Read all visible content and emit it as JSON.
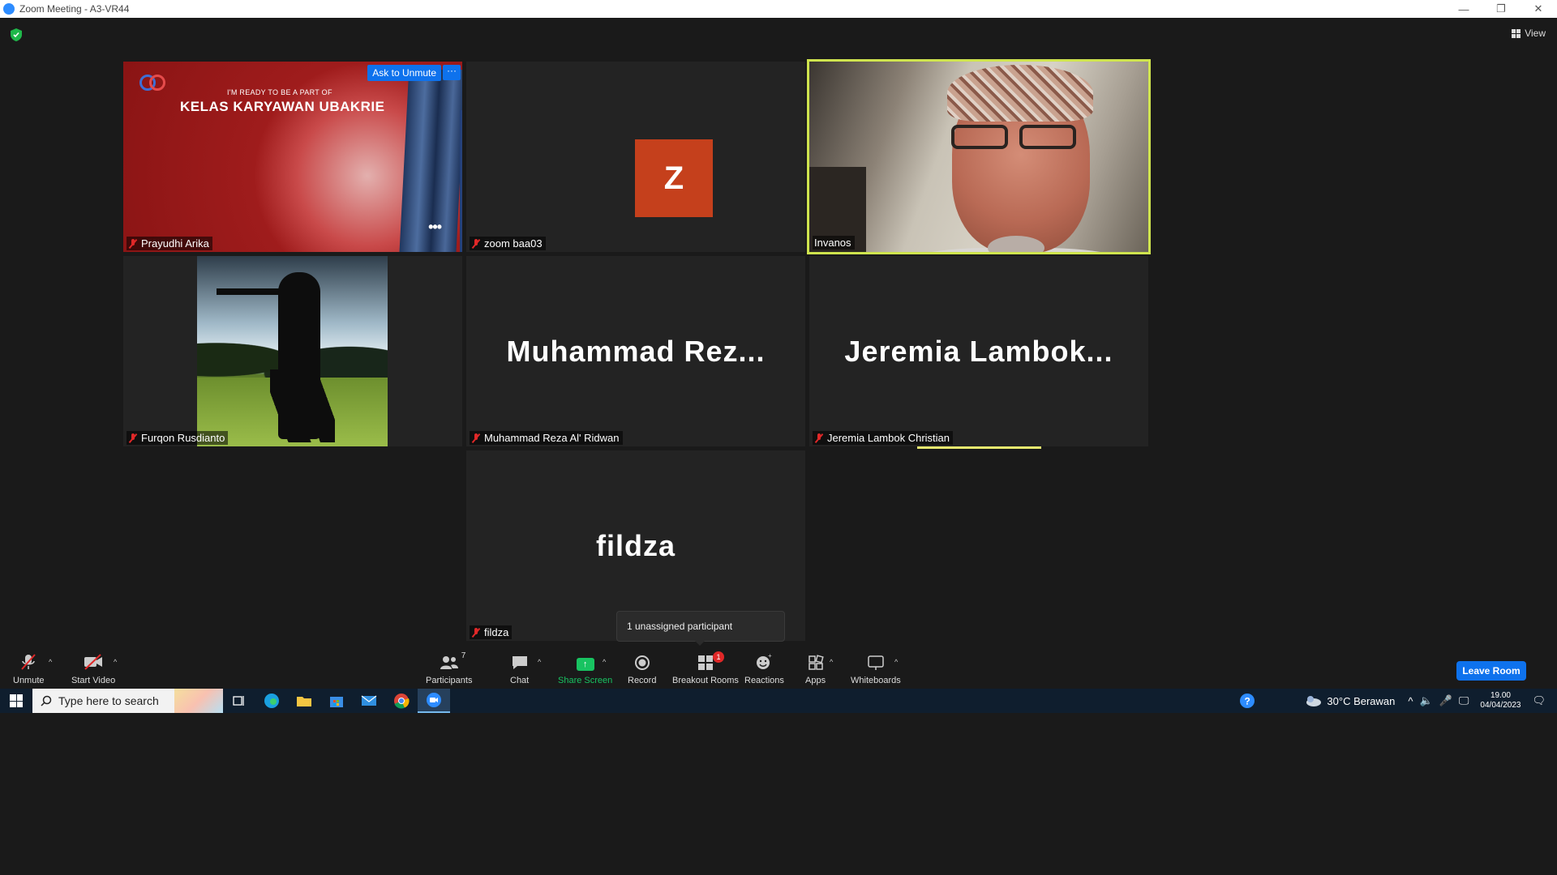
{
  "window": {
    "title": "Zoom Meeting - A3-VR44",
    "minimize": "—",
    "restore": "❐",
    "close": "✕"
  },
  "view_label": "View",
  "tiles": [
    {
      "name": "Prayudhi Arika",
      "muted": true
    },
    {
      "name": "zoom baa03",
      "avatar_letter": "Z",
      "muted": true
    },
    {
      "name": "Invanos",
      "muted": false,
      "active_speaker": true
    },
    {
      "name": "Furqon Rusdianto",
      "muted": true
    },
    {
      "name": "Muhammad Reza Al' Ridwan",
      "display": "Muhammad  Rez...",
      "muted": true
    },
    {
      "name": "Jeremia Lambok Christian",
      "display": "Jeremia  Lambok...",
      "muted": true
    },
    {
      "name": "fildza",
      "display": "fildza",
      "muted": true
    }
  ],
  "presentation": {
    "small_text": "I'M READY TO BE A PART OF",
    "big_text": "KELAS KARYAWAN UBAKRIE"
  },
  "ask_to_unmute": "Ask to Unmute",
  "more_options": "···",
  "unassigned_popup": "1 unassigned participant",
  "toolbar": {
    "unmute": "Unmute",
    "start_video": "Start Video",
    "participants": "Participants",
    "participants_count": "7",
    "chat": "Chat",
    "share_screen": "Share Screen",
    "record": "Record",
    "breakout_rooms": "Breakout Rooms",
    "breakout_badge": "1",
    "reactions": "Reactions",
    "apps": "Apps",
    "whiteboards": "Whiteboards",
    "leave_room": "Leave Room"
  },
  "taskbar": {
    "search_placeholder": "Type here to search",
    "weather": "30°C  Berawan",
    "time": "19.00",
    "date": "04/04/2023"
  },
  "colors": {
    "accent": "#0e72ed",
    "active_border": "#cfe44e",
    "muted": "#e02828",
    "share": "#18c361",
    "avatar_z": "#c5401c"
  }
}
